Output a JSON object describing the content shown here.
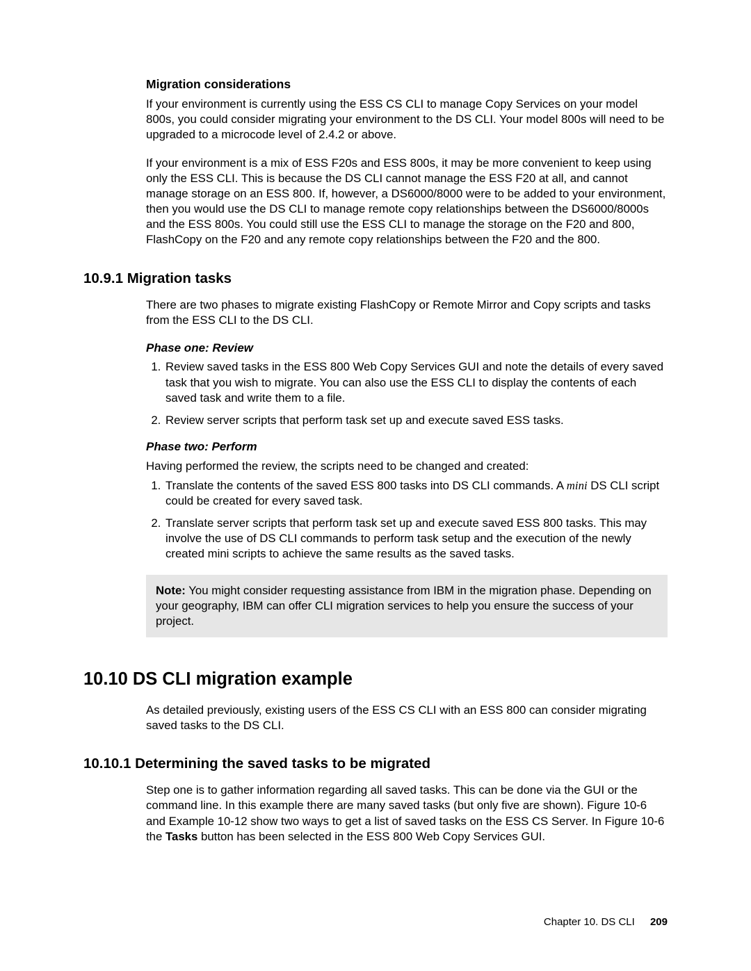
{
  "sec_mc": {
    "title": "Migration considerations",
    "p1": "If your environment is currently using the ESS CS CLI to manage Copy Services on your model 800s, you could consider migrating your environment to the DS CLI. Your model 800s will need to be upgraded to a microcode level of 2.4.2 or above.",
    "p2": "If your environment is a mix of ESS F20s and ESS 800s, it may be more convenient to keep using only the ESS CLI. This is because the DS CLI cannot manage the ESS F20 at all, and cannot manage storage on an ESS 800. If, however, a DS6000/8000 were to be added to your environment, then you would use the DS CLI to manage remote copy relationships between the DS6000/8000s and the ESS 800s. You could still use the ESS CLI to manage the storage on the F20 and 800, FlashCopy on the F20 and any remote copy relationships between the F20 and the 800."
  },
  "sec_mt": {
    "num_title": "10.9.1  Migration tasks",
    "p1": "There are two phases to migrate existing FlashCopy or Remote Mirror and Copy scripts and tasks from the ESS CLI to the DS CLI.",
    "phase1_title": "Phase one: Review",
    "phase1_li1": "Review saved tasks in the ESS 800 Web Copy Services GUI and note the details of every saved task that you wish to migrate. You can also use the ESS CLI to display the contents of each saved task and write them to a file.",
    "phase1_li2": "Review server scripts that perform task set up and execute saved ESS tasks.",
    "phase2_title": "Phase two: Perform",
    "phase2_intro": "Having performed the review, the scripts need to be changed and created:",
    "phase2_li1a": "Translate the contents of the saved ESS 800 tasks into DS CLI commands. A ",
    "phase2_li1_mini": "mini",
    "phase2_li1b": " DS CLI script could be created for every saved task.",
    "phase2_li2": "Translate server scripts that perform task set up and execute saved ESS 800 tasks. This may involve the use of DS CLI commands to perform task setup and the execution of the newly created mini scripts to achieve the same results as the saved tasks.",
    "note_label": "Note:",
    "note_body": " You might consider requesting assistance from IBM in the migration phase. Depending on your geography, IBM can offer CLI migration services to help you ensure the success of your project."
  },
  "sec_ex": {
    "num_title": "10.10  DS CLI migration example",
    "p1": "As detailed previously, existing users of the ESS CS CLI with an ESS 800 can consider migrating saved tasks to the DS CLI."
  },
  "sec_det": {
    "num_title": "10.10.1  Determining the saved tasks to be migrated",
    "p1a": "Step one is to gather information regarding all saved tasks. This can be done via the GUI or the command line. In this example there are many saved tasks (but only five are shown). Figure 10-6 and Example 10-12 show two ways to get a list of saved tasks on the ESS CS Server. In Figure 10-6 the ",
    "p1_bold": "Tasks",
    "p1b": " button has been selected in the ESS 800 Web Copy Services GUI."
  },
  "footer": {
    "chapter": "Chapter 10. DS CLI",
    "page": "209"
  }
}
